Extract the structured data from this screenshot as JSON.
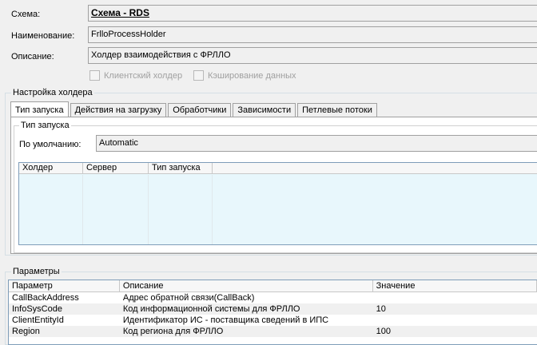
{
  "form": {
    "schema_label": "Схема:",
    "schema_value": "Схема - RDS",
    "name_label": "Наименование:",
    "name_value": "FrlloProcessHolder",
    "description_label": "Описание:",
    "description_value": "Холдер взаимодействия с ФРЛЛО",
    "client_holder_label": "Клиентский холдер",
    "caching_label": "Кэширование данных"
  },
  "holder_settings": {
    "title": "Настройка холдера",
    "tabs": [
      {
        "label": "Тип запуска",
        "active": true
      },
      {
        "label": "Действия на загрузку",
        "active": false
      },
      {
        "label": "Обработчики",
        "active": false
      },
      {
        "label": "Зависимости",
        "active": false
      },
      {
        "label": "Петлевые потоки",
        "active": false
      }
    ],
    "launch_group_title": "Тип запуска",
    "default_label": "По умолчанию:",
    "default_value": "Automatic",
    "grid_headers": [
      "Холдер",
      "Сервер",
      "Тип запуска"
    ]
  },
  "parameters": {
    "title": "Параметры",
    "headers": [
      "Параметр",
      "Описание",
      "Значение"
    ],
    "rows": [
      {
        "param": "CallBackAddress",
        "description": "Адрес обратной связи(CallBack)",
        "value": ""
      },
      {
        "param": "InfoSysCode",
        "description": "Код информационной системы для ФРЛЛО",
        "value": "10"
      },
      {
        "param": "ClientEntityId",
        "description": "Идентификатор ИС - поставщика сведений в ИПС",
        "value": ""
      },
      {
        "param": "Region",
        "description": "Код региона для ФРЛЛО",
        "value": "100"
      }
    ]
  }
}
